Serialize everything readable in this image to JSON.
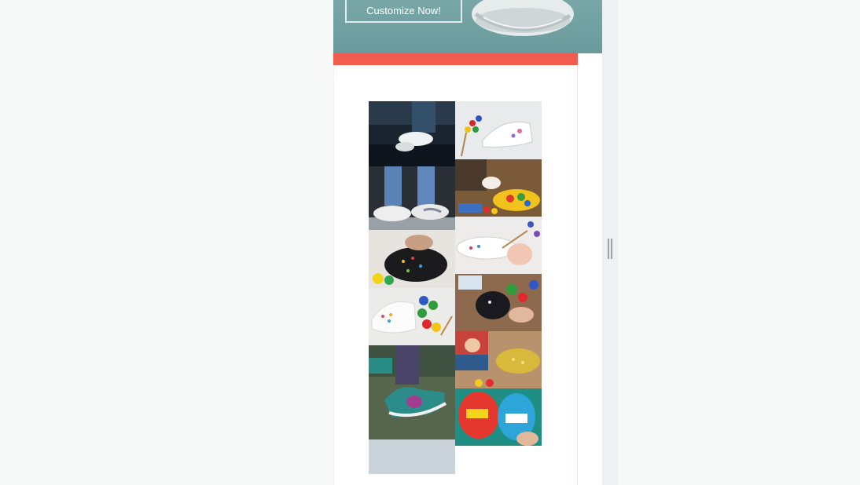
{
  "hero": {
    "cta_label": "Customize Now!"
  },
  "colors": {
    "accent": "#f25c4e",
    "hero_bg": "#6f9fa1"
  },
  "gallery": {
    "tiles": [
      {
        "icon": "photo-sneakers-car"
      },
      {
        "icon": "photo-painted-sneaker-paints"
      },
      {
        "icon": "photo-jeans-sneakers"
      },
      {
        "icon": "photo-painting-colorful-sneaker"
      },
      {
        "icon": "photo-painting-dark-sneaker"
      },
      {
        "icon": "photo-painting-white-shoe"
      },
      {
        "icon": "photo-white-shoe-paint-jars"
      },
      {
        "icon": "photo-dark-shoe-palette"
      },
      {
        "icon": "photo-teal-sneaker-jump"
      },
      {
        "icon": "photo-kid-painting-gold-shoe"
      },
      {
        "icon": "photo-pop-art-sneakers"
      }
    ]
  }
}
